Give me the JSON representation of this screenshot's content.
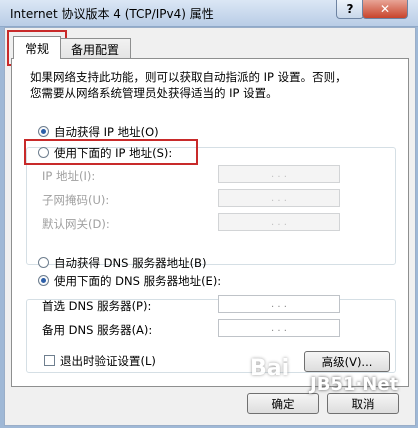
{
  "window": {
    "title": "Internet 协议版本 4 (TCP/IPv4) 属性",
    "help_label": "?",
    "close_label": "✕"
  },
  "tabs": [
    {
      "label": "常规",
      "active": true
    },
    {
      "label": "备用配置",
      "active": false
    }
  ],
  "description": {
    "line1": "如果网络支持此功能，则可以获取自动指派的 IP 设置。否则，",
    "line2": "您需要从网络系统管理员处获得适当的 IP 设置。"
  },
  "ip_group": {
    "auto_label": "自动获得 IP 地址(O)",
    "manual_label": "使用下面的 IP 地址(S):",
    "fields": [
      {
        "label": "IP 地址(I):",
        "value": ". . ."
      },
      {
        "label": "子网掩码(U):",
        "value": ". . ."
      },
      {
        "label": "默认网关(D):",
        "value": ". . ."
      }
    ]
  },
  "dns_group": {
    "auto_label": "自动获得 DNS 服务器地址(B)",
    "manual_label": "使用下面的 DNS 服务器地址(E):",
    "fields": [
      {
        "label": "首选 DNS 服务器(P):",
        "value": ". . ."
      },
      {
        "label": "备用 DNS 服务器(A):",
        "value": ". . ."
      }
    ]
  },
  "validate": {
    "label": "退出时验证设置(L)"
  },
  "buttons": {
    "advanced": "高级(V)...",
    "ok": "确定",
    "cancel": "取消"
  },
  "watermark": {
    "text1": "Bai",
    "text2": "JB51·Net"
  }
}
